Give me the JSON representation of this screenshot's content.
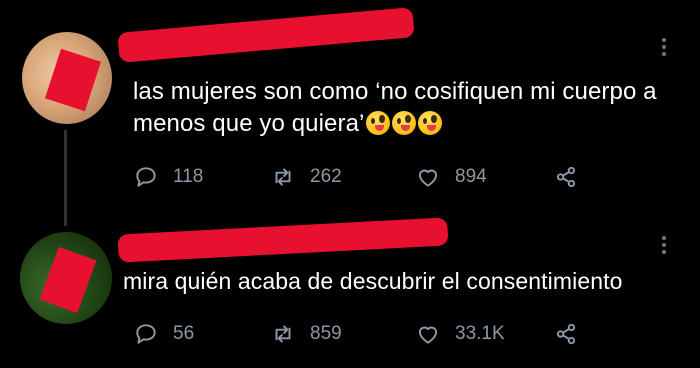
{
  "tweets": [
    {
      "text": "las mujeres son como ‘no cosifiquen mi cuerpo a menos que yo quiera’",
      "emojis": [
        "zany-face",
        "zany-face",
        "zany-face"
      ],
      "counts": {
        "replies": "118",
        "retweets": "262",
        "likes": "894"
      }
    },
    {
      "text": "mira quién acaba de descubrir el consentimiento",
      "counts": {
        "replies": "56",
        "retweets": "859",
        "likes": "33.1K"
      }
    }
  ],
  "colors": {
    "background": "#000000",
    "text": "#ffffff",
    "muted": "#8b98a5",
    "redaction": "#e8102f"
  }
}
